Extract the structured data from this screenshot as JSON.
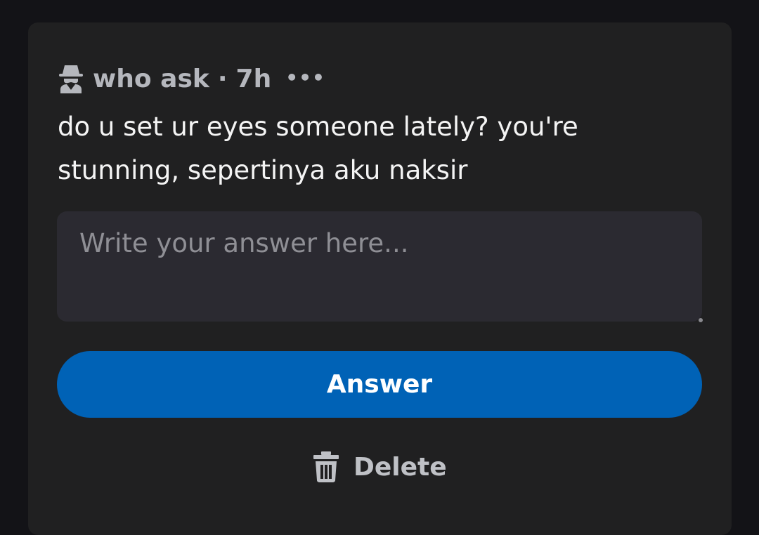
{
  "question": {
    "author": "who ask",
    "separator": "·",
    "time": "7h",
    "more_icon": "more-horizontal-icon",
    "author_icon": "spy-icon",
    "text": "do u set ur eyes someone lately? you're stunning, sepertinya aku naksir"
  },
  "answer": {
    "placeholder": "Write your answer here...",
    "value": "",
    "button_label": "Answer",
    "button_color": "#0062b6"
  },
  "delete": {
    "label": "Delete",
    "icon": "trash-icon"
  },
  "colors": {
    "background": "#131317",
    "card": "#202021",
    "input": "#2b2a31",
    "meta_text": "#b5b7bd",
    "question_text": "#f4f4f4"
  }
}
